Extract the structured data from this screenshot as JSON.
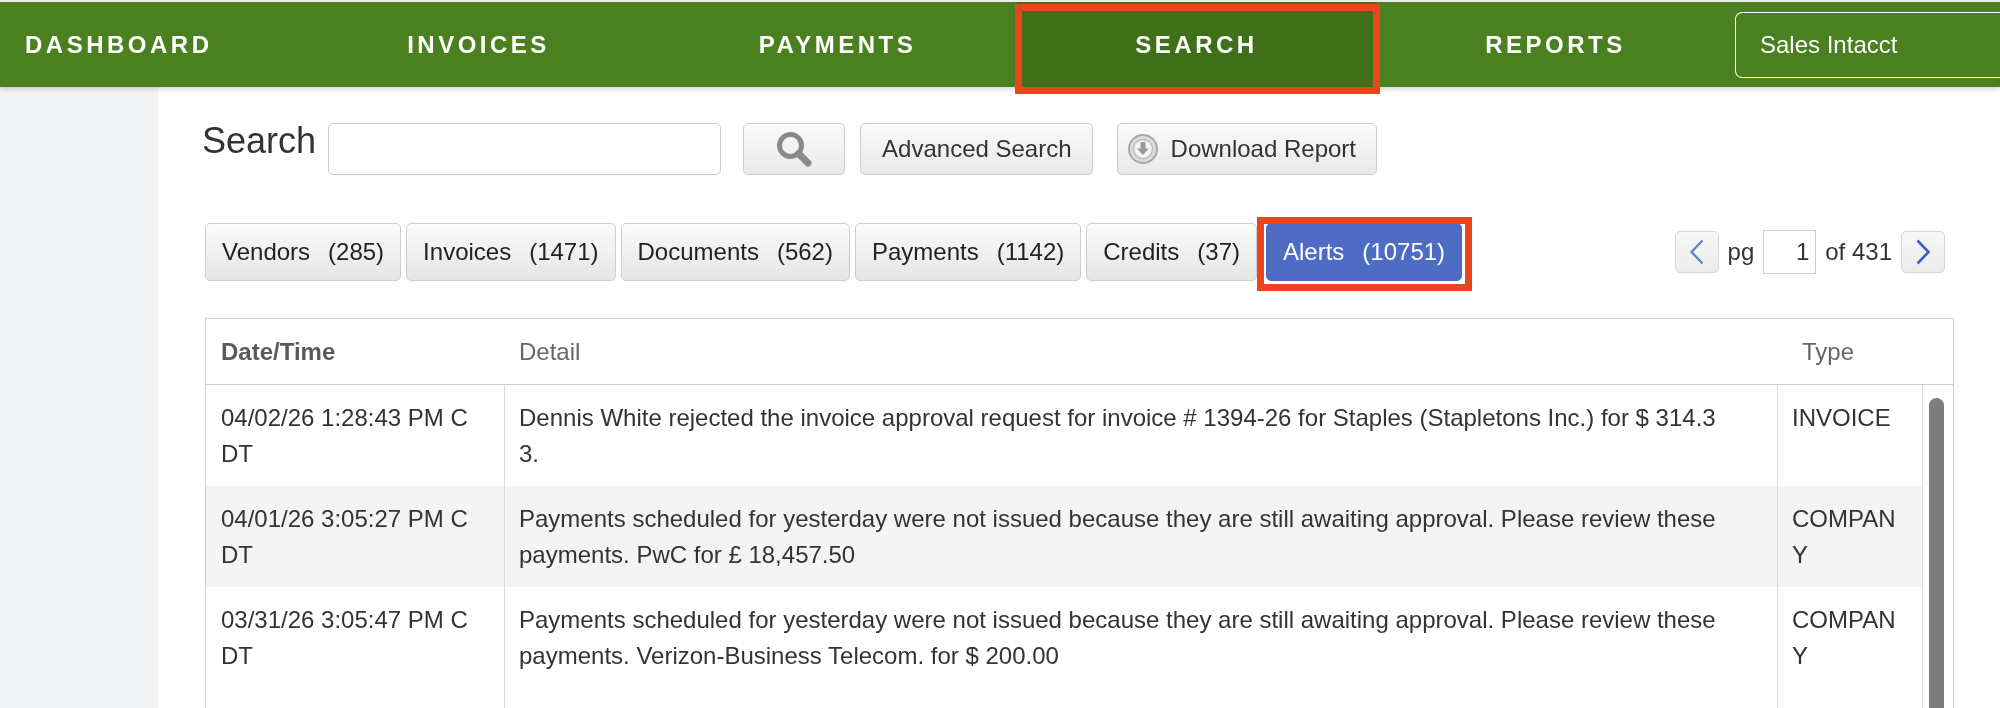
{
  "nav": {
    "items": [
      {
        "label": "DASHBOARD",
        "selected": false,
        "highlighted": false
      },
      {
        "label": "INVOICES",
        "selected": false,
        "highlighted": false
      },
      {
        "label": "PAYMENTS",
        "selected": false,
        "highlighted": false
      },
      {
        "label": "SEARCH",
        "selected": true,
        "highlighted": true
      },
      {
        "label": "REPORTS",
        "selected": false,
        "highlighted": false
      }
    ],
    "company": "Sales Intacct"
  },
  "search": {
    "label": "Search",
    "buttons": [
      {
        "kind": "search"
      },
      {
        "kind": "advanced",
        "label": "Advanced Search"
      },
      {
        "kind": "download",
        "label": "Download Report"
      }
    ]
  },
  "tabs": [
    {
      "label": "Vendors",
      "count": "(285)",
      "selected": false,
      "highlighted": false
    },
    {
      "label": "Invoices",
      "count": "(1471)",
      "selected": false,
      "highlighted": false
    },
    {
      "label": "Documents",
      "count": "(562)",
      "selected": false,
      "highlighted": false
    },
    {
      "label": "Payments",
      "count": "(1142)",
      "selected": false,
      "highlighted": false
    },
    {
      "label": "Credits",
      "count": "(37)",
      "selected": false,
      "highlighted": false
    },
    {
      "label": "Alerts",
      "count": "(10751)",
      "selected": true,
      "highlighted": true
    }
  ],
  "pagination": {
    "label": "pg",
    "page": "1",
    "total": "of 431"
  },
  "table": {
    "columns": [
      {
        "label": "Date/Time",
        "sorted": true
      },
      {
        "label": "Detail",
        "sorted": false
      },
      {
        "label": "Type",
        "sorted": false
      }
    ],
    "rows": [
      {
        "date_time": "04/02/26 1:28:43 PM CDT",
        "detail": "Dennis White rejected the invoice approval request for invoice # 1394-26 for Staples (Stapletons Inc.) for $ 314.33.",
        "type": "INVOICE"
      },
      {
        "date_time": "04/01/26 3:05:27 PM CDT",
        "detail": "Payments scheduled for yesterday were not issued because they are still awaiting approval. Please review these payments. PwC for £ 18,457.50",
        "type": "COMPANY"
      },
      {
        "date_time": "03/31/26 3:05:47 PM CDT",
        "detail": "Payments scheduled for yesterday were not issued because they are still awaiting approval. Please review these payments. Verizon-Business Telecom. for $ 200.00",
        "type": "COMPANY"
      }
    ]
  }
}
